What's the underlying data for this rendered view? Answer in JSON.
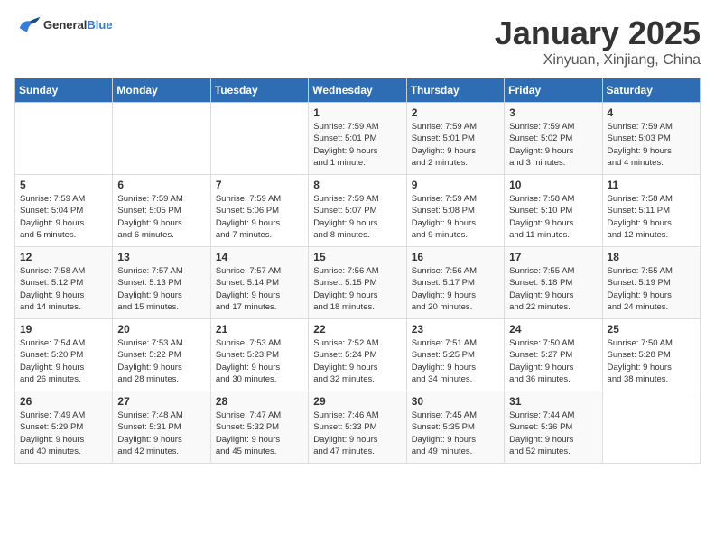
{
  "logo": {
    "text_general": "General",
    "text_blue": "Blue"
  },
  "header": {
    "month_title": "January 2025",
    "subtitle": "Xinyuan, Xinjiang, China"
  },
  "weekdays": [
    "Sunday",
    "Monday",
    "Tuesday",
    "Wednesday",
    "Thursday",
    "Friday",
    "Saturday"
  ],
  "weeks": [
    [
      {
        "day": "",
        "info": ""
      },
      {
        "day": "",
        "info": ""
      },
      {
        "day": "",
        "info": ""
      },
      {
        "day": "1",
        "info": "Sunrise: 7:59 AM\nSunset: 5:01 PM\nDaylight: 9 hours\nand 1 minute."
      },
      {
        "day": "2",
        "info": "Sunrise: 7:59 AM\nSunset: 5:01 PM\nDaylight: 9 hours\nand 2 minutes."
      },
      {
        "day": "3",
        "info": "Sunrise: 7:59 AM\nSunset: 5:02 PM\nDaylight: 9 hours\nand 3 minutes."
      },
      {
        "day": "4",
        "info": "Sunrise: 7:59 AM\nSunset: 5:03 PM\nDaylight: 9 hours\nand 4 minutes."
      }
    ],
    [
      {
        "day": "5",
        "info": "Sunrise: 7:59 AM\nSunset: 5:04 PM\nDaylight: 9 hours\nand 5 minutes."
      },
      {
        "day": "6",
        "info": "Sunrise: 7:59 AM\nSunset: 5:05 PM\nDaylight: 9 hours\nand 6 minutes."
      },
      {
        "day": "7",
        "info": "Sunrise: 7:59 AM\nSunset: 5:06 PM\nDaylight: 9 hours\nand 7 minutes."
      },
      {
        "day": "8",
        "info": "Sunrise: 7:59 AM\nSunset: 5:07 PM\nDaylight: 9 hours\nand 8 minutes."
      },
      {
        "day": "9",
        "info": "Sunrise: 7:59 AM\nSunset: 5:08 PM\nDaylight: 9 hours\nand 9 minutes."
      },
      {
        "day": "10",
        "info": "Sunrise: 7:58 AM\nSunset: 5:10 PM\nDaylight: 9 hours\nand 11 minutes."
      },
      {
        "day": "11",
        "info": "Sunrise: 7:58 AM\nSunset: 5:11 PM\nDaylight: 9 hours\nand 12 minutes."
      }
    ],
    [
      {
        "day": "12",
        "info": "Sunrise: 7:58 AM\nSunset: 5:12 PM\nDaylight: 9 hours\nand 14 minutes."
      },
      {
        "day": "13",
        "info": "Sunrise: 7:57 AM\nSunset: 5:13 PM\nDaylight: 9 hours\nand 15 minutes."
      },
      {
        "day": "14",
        "info": "Sunrise: 7:57 AM\nSunset: 5:14 PM\nDaylight: 9 hours\nand 17 minutes."
      },
      {
        "day": "15",
        "info": "Sunrise: 7:56 AM\nSunset: 5:15 PM\nDaylight: 9 hours\nand 18 minutes."
      },
      {
        "day": "16",
        "info": "Sunrise: 7:56 AM\nSunset: 5:17 PM\nDaylight: 9 hours\nand 20 minutes."
      },
      {
        "day": "17",
        "info": "Sunrise: 7:55 AM\nSunset: 5:18 PM\nDaylight: 9 hours\nand 22 minutes."
      },
      {
        "day": "18",
        "info": "Sunrise: 7:55 AM\nSunset: 5:19 PM\nDaylight: 9 hours\nand 24 minutes."
      }
    ],
    [
      {
        "day": "19",
        "info": "Sunrise: 7:54 AM\nSunset: 5:20 PM\nDaylight: 9 hours\nand 26 minutes."
      },
      {
        "day": "20",
        "info": "Sunrise: 7:53 AM\nSunset: 5:22 PM\nDaylight: 9 hours\nand 28 minutes."
      },
      {
        "day": "21",
        "info": "Sunrise: 7:53 AM\nSunset: 5:23 PM\nDaylight: 9 hours\nand 30 minutes."
      },
      {
        "day": "22",
        "info": "Sunrise: 7:52 AM\nSunset: 5:24 PM\nDaylight: 9 hours\nand 32 minutes."
      },
      {
        "day": "23",
        "info": "Sunrise: 7:51 AM\nSunset: 5:25 PM\nDaylight: 9 hours\nand 34 minutes."
      },
      {
        "day": "24",
        "info": "Sunrise: 7:50 AM\nSunset: 5:27 PM\nDaylight: 9 hours\nand 36 minutes."
      },
      {
        "day": "25",
        "info": "Sunrise: 7:50 AM\nSunset: 5:28 PM\nDaylight: 9 hours\nand 38 minutes."
      }
    ],
    [
      {
        "day": "26",
        "info": "Sunrise: 7:49 AM\nSunset: 5:29 PM\nDaylight: 9 hours\nand 40 minutes."
      },
      {
        "day": "27",
        "info": "Sunrise: 7:48 AM\nSunset: 5:31 PM\nDaylight: 9 hours\nand 42 minutes."
      },
      {
        "day": "28",
        "info": "Sunrise: 7:47 AM\nSunset: 5:32 PM\nDaylight: 9 hours\nand 45 minutes."
      },
      {
        "day": "29",
        "info": "Sunrise: 7:46 AM\nSunset: 5:33 PM\nDaylight: 9 hours\nand 47 minutes."
      },
      {
        "day": "30",
        "info": "Sunrise: 7:45 AM\nSunset: 5:35 PM\nDaylight: 9 hours\nand 49 minutes."
      },
      {
        "day": "31",
        "info": "Sunrise: 7:44 AM\nSunset: 5:36 PM\nDaylight: 9 hours\nand 52 minutes."
      },
      {
        "day": "",
        "info": ""
      }
    ]
  ]
}
